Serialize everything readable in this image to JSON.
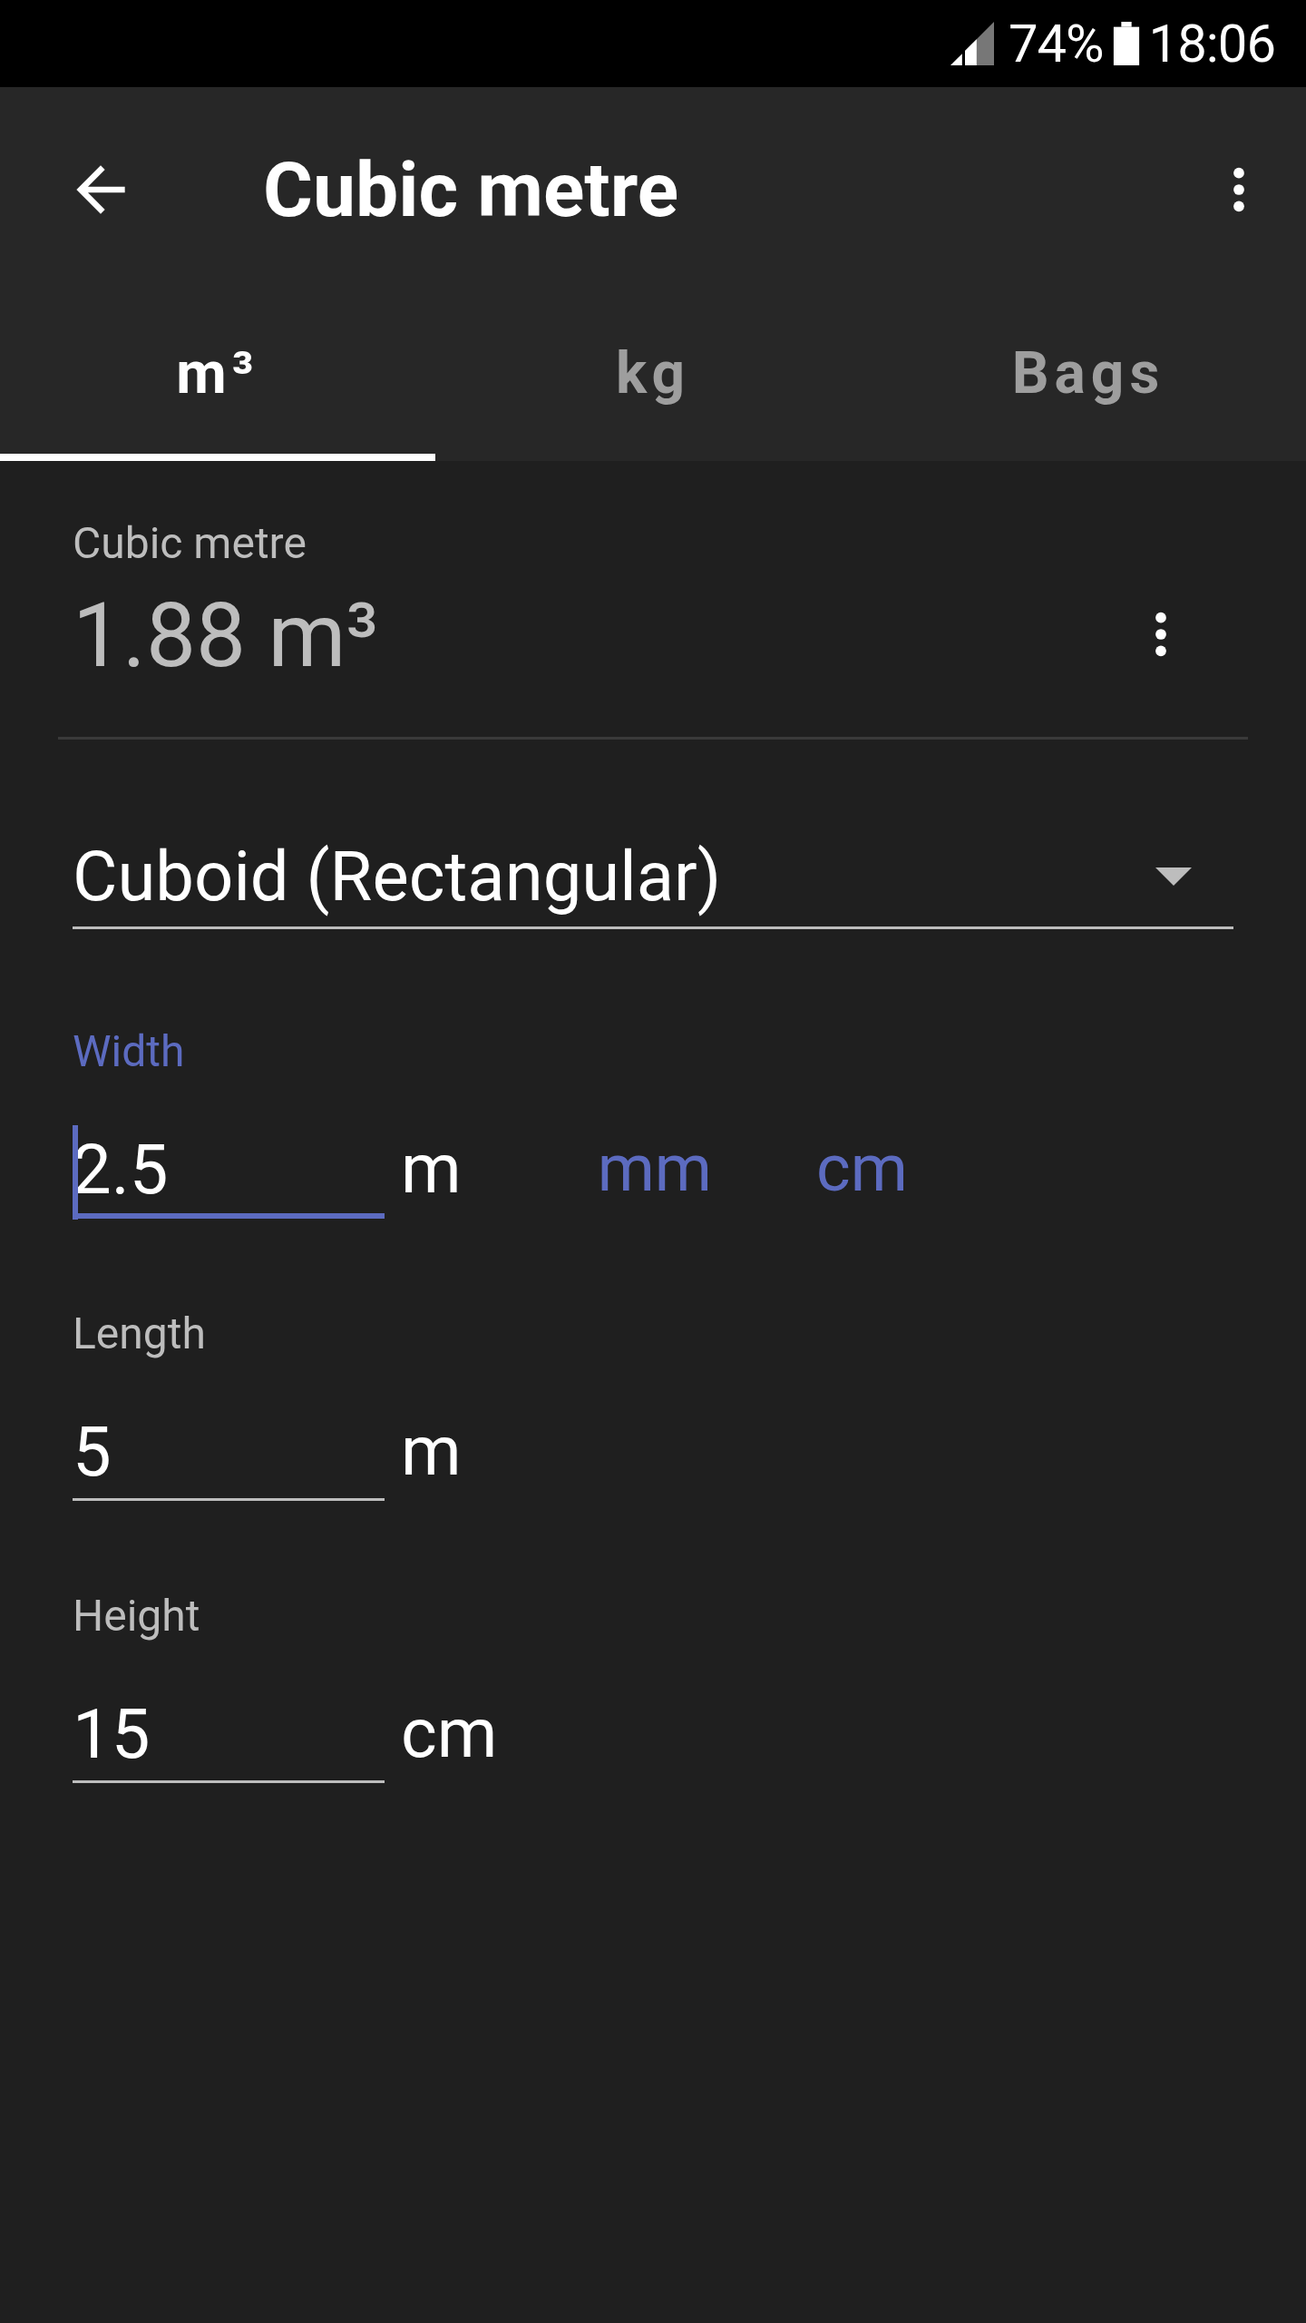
{
  "status_bar": {
    "battery": "74%",
    "time": "18:06"
  },
  "toolbar": {
    "title": "Cubic metre"
  },
  "tabs": [
    {
      "label": "m³",
      "selected": true
    },
    {
      "label": "kg",
      "selected": false
    },
    {
      "label": "Bags",
      "selected": false
    }
  ],
  "result": {
    "label": "Cubic metre",
    "value": "1.88 m³"
  },
  "shape_dropdown": {
    "value": "Cuboid (Rectangular)"
  },
  "inputs": [
    {
      "label": "Width",
      "value": "2.5",
      "unit": "m",
      "focused": true,
      "unit_options": [
        "mm",
        "cm"
      ]
    },
    {
      "label": "Length",
      "value": "5",
      "unit": "m",
      "focused": false
    },
    {
      "label": "Height",
      "value": "15",
      "unit": "cm",
      "focused": false
    }
  ]
}
